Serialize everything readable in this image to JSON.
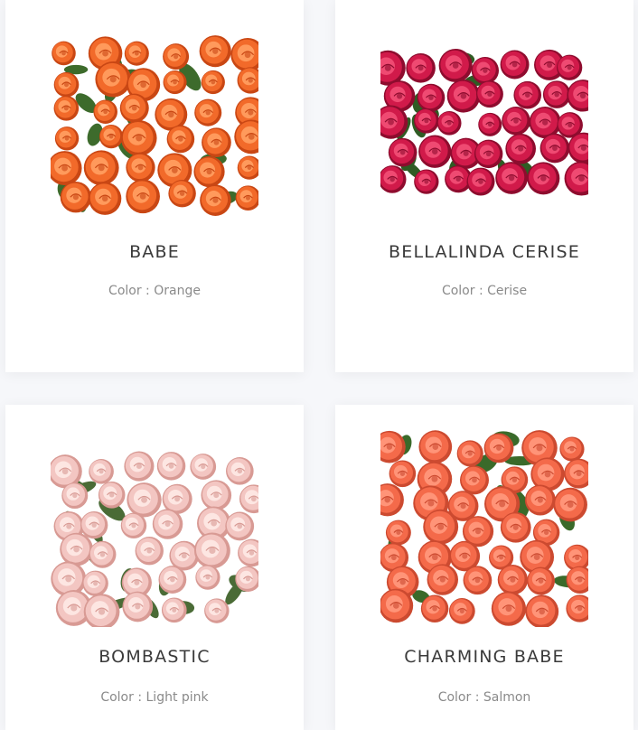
{
  "products": [
    {
      "name": "BABE",
      "color_prefix": "Color : ",
      "color": "Orange",
      "image": "orange-spray-roses-icon",
      "tone": {
        "base": "#f26a2a",
        "light": "#ff9a5c",
        "dark": "#c94714",
        "leaf": "#3d6b2c"
      }
    },
    {
      "name": "BELLALINDA CERISE",
      "color_prefix": "Color : ",
      "color": "Cerise",
      "image": "cerise-roses-icon",
      "tone": {
        "base": "#d11a4a",
        "light": "#ef4a72",
        "dark": "#8e0c2e",
        "leaf": "#2f5c24"
      }
    },
    {
      "name": "BOMBASTIC",
      "color_prefix": "Color : ",
      "color": "Light pink",
      "image": "light-pink-roses-icon",
      "tone": {
        "base": "#f3c6c2",
        "light": "#fde6e2",
        "dark": "#d89a94",
        "leaf": "#4a6b36"
      }
    },
    {
      "name": "CHARMING BABE",
      "color_prefix": "Color : ",
      "color": "Salmon",
      "image": "salmon-roses-icon",
      "tone": {
        "base": "#f46a4a",
        "light": "#ff9478",
        "dark": "#cc4a30",
        "leaf": "#3a6a2a"
      }
    }
  ]
}
